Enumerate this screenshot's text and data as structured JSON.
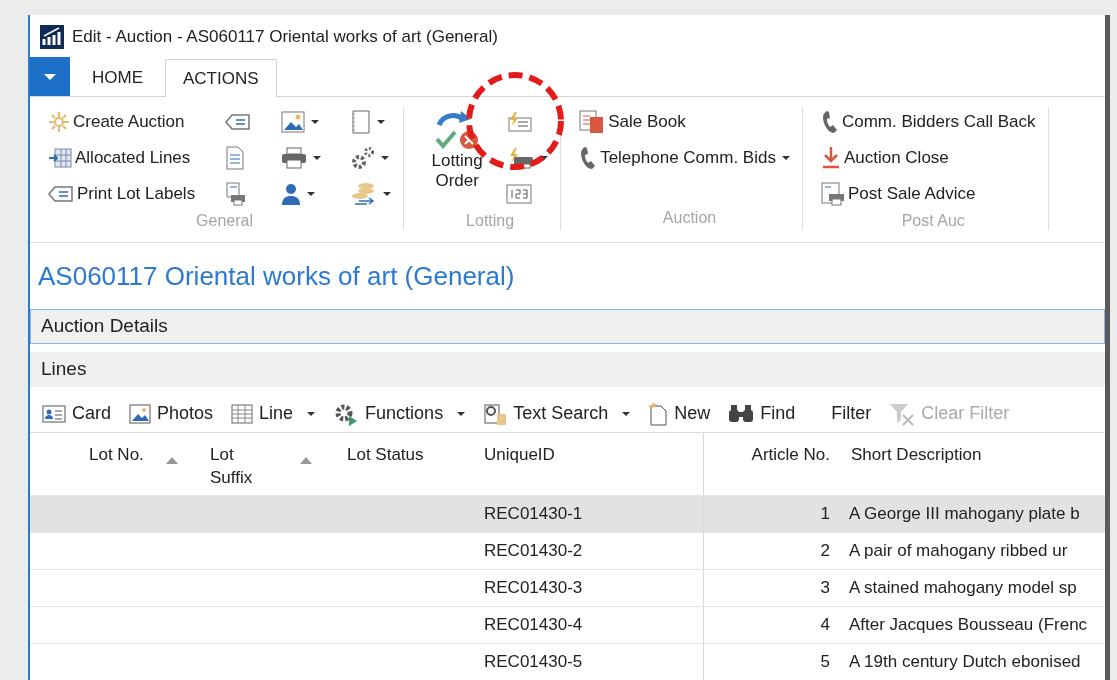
{
  "window": {
    "title": "Edit - Auction - AS060117 Oriental works of art (General)"
  },
  "tabs": [
    {
      "label": "HOME",
      "selected": false
    },
    {
      "label": "ACTIONS",
      "selected": true
    }
  ],
  "ribbon": {
    "groups": [
      {
        "label": "General",
        "columns": [
          {
            "items": [
              {
                "label": "Create Auction"
              },
              {
                "label": "Allocated Lines"
              },
              {
                "label": "Print Lot Labels"
              }
            ]
          },
          {
            "items": [
              {
                "dropdown": false
              },
              {
                "dropdown": false
              },
              {
                "dropdown": false
              }
            ]
          },
          {
            "items": [
              {
                "dropdown": true
              },
              {
                "dropdown": true
              },
              {
                "dropdown": true
              }
            ]
          },
          {
            "items": [
              {
                "dropdown": true
              },
              {
                "dropdown": true
              },
              {
                "dropdown": true
              }
            ]
          }
        ]
      },
      {
        "label": "Lotting",
        "columns": [
          {
            "items": [
              {
                "kind": "large",
                "label": "Lotting Order"
              }
            ]
          },
          {
            "items": [
              {
                "dropdown": false
              },
              {
                "dropdown": true
              },
              {
                "dropdown": false
              }
            ]
          }
        ]
      },
      {
        "label": "Auction",
        "columns": [
          {
            "items": [
              {
                "label": "Sale Book"
              },
              {
                "label": "Telephone Comm. Bids",
                "dropdown": true
              }
            ]
          }
        ]
      },
      {
        "label": "Post Auc",
        "columns": [
          {
            "items": [
              {
                "label": "Comm. Bidders Call Back"
              },
              {
                "label": "Auction Close"
              },
              {
                "label": "Post Sale Advice"
              }
            ]
          }
        ]
      }
    ]
  },
  "page_title": "AS060117 Oriental works of art (General)",
  "sections": [
    {
      "label": "Auction Details",
      "focused": true
    },
    {
      "label": "Lines",
      "focused": false
    }
  ],
  "toolbar": [
    {
      "label": "Card",
      "dropdown": false,
      "disabled": false
    },
    {
      "label": "Photos",
      "dropdown": false,
      "disabled": false
    },
    {
      "label": "Line",
      "dropdown": true,
      "disabled": false
    },
    {
      "label": "Functions",
      "dropdown": true,
      "disabled": false
    },
    {
      "label": "Text Search",
      "dropdown": true,
      "disabled": false
    },
    {
      "label": "New",
      "dropdown": false,
      "disabled": false
    },
    {
      "label": "Find",
      "dropdown": false,
      "disabled": false
    },
    {
      "kind": "text",
      "label": "Filter",
      "dropdown": false,
      "disabled": false
    },
    {
      "label": "Clear Filter",
      "dropdown": false,
      "disabled": true
    }
  ],
  "table": {
    "columns": [
      {
        "label": "Lot No.",
        "sorted": true
      },
      {
        "label": "Lot\nSuffix",
        "sorted": true
      },
      {
        "label": "Lot Status"
      },
      {
        "label": "UniqueID"
      },
      {
        "label": "Article No."
      },
      {
        "label": "Short Description"
      }
    ],
    "rows": [
      {
        "unique_id": "REC01430-1",
        "article_no": "1",
        "short_description": "A George III mahogany plate b",
        "selected": true
      },
      {
        "unique_id": "REC01430-2",
        "article_no": "2",
        "short_description": "A pair of mahogany ribbed ur",
        "selected": false
      },
      {
        "unique_id": "REC01430-3",
        "article_no": "3",
        "short_description": "A stained mahogany model sp",
        "selected": false
      },
      {
        "unique_id": "REC01430-4",
        "article_no": "4",
        "short_description": "After Jacques Bousseau (Frenc",
        "selected": false
      },
      {
        "unique_id": "REC01430-5",
        "article_no": "5",
        "short_description": "A 19th century Dutch ebonised",
        "selected": false
      }
    ]
  }
}
